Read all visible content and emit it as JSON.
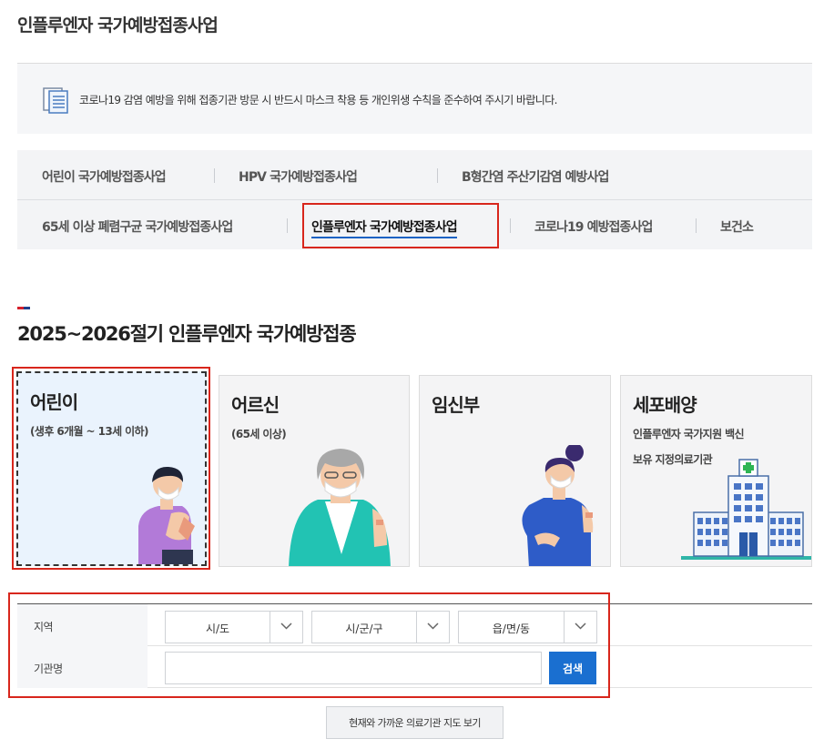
{
  "page_title": "인플루엔자 국가예방접종사업",
  "notice": {
    "text": "코로나19 감염 예방을 위해 접종기관 방문 시 반드시 마스크 착용 등 개인위생 수칙을 준수하여 주시기 바랍니다."
  },
  "tabs": [
    {
      "label": "어린이 국가예방접종사업"
    },
    {
      "label": "HPV 국가예방접종사업"
    },
    {
      "label": "B형간염 주산기감염 예방사업"
    },
    {
      "label": "65세 이상 폐렴구균 국가예방접종사업"
    },
    {
      "label": "인플루엔자 국가예방접종사업",
      "active": true
    },
    {
      "label": "코로나19 예방접종사업"
    },
    {
      "label": "보건소"
    }
  ],
  "section": {
    "title": "2025~2026절기 인플루엔자 국가예방접종"
  },
  "cards": [
    {
      "title": "어린이",
      "sub": [
        "(생후 6개월 ~ 13세 이하)"
      ],
      "icon": "child-icon",
      "selected": true
    },
    {
      "title": "어르신",
      "sub": [
        "(65세 이상)"
      ],
      "icon": "elderly-icon"
    },
    {
      "title": "임신부",
      "sub": [],
      "icon": "pregnant-woman-icon"
    },
    {
      "title": "세포배양",
      "sub": [
        "인플루엔자 국가지원 백신",
        "보유 지정의료기관"
      ],
      "icon": "hospital-icon"
    }
  ],
  "search": {
    "region_label": "지역",
    "institution_label": "기관명",
    "selects": [
      {
        "value": "시/도"
      },
      {
        "value": "시/군/구"
      },
      {
        "value": "읍/면/동"
      }
    ],
    "institution_value": "",
    "button_label": "검색"
  },
  "map_button_label": "현재와 가까운 의료기관 지도 보기",
  "colors": {
    "accent_blue": "#1a6fd0",
    "highlight_red": "#d8261c",
    "selected_card_bg": "#eaf3fd"
  }
}
